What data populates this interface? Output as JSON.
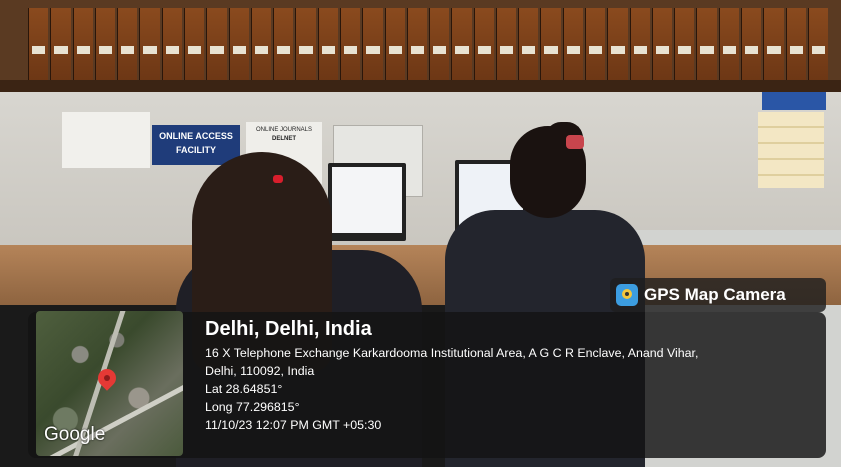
{
  "overlay": {
    "app_badge": "GPS Map Camera",
    "app_icon": "gps-map-camera-icon",
    "map_attribution": "Google",
    "city": "Delhi, Delhi, India",
    "address_line1": "16 X Telephone Exchange Karkardooma Institutional Area, A G C R Enclave, Anand Vihar,",
    "address_line2": "Delhi, 110092, India",
    "latitude": "Lat 28.64851°",
    "longitude": "Long 77.296815°",
    "timestamp": "11/10/23 12:07 PM GMT +05:30"
  },
  "scene": {
    "sign_main": "ONLINE ACCESS FACILITY",
    "sign_secondary_title": "ONLINE JOURNALS",
    "sign_secondary_sub": "DELNET"
  }
}
